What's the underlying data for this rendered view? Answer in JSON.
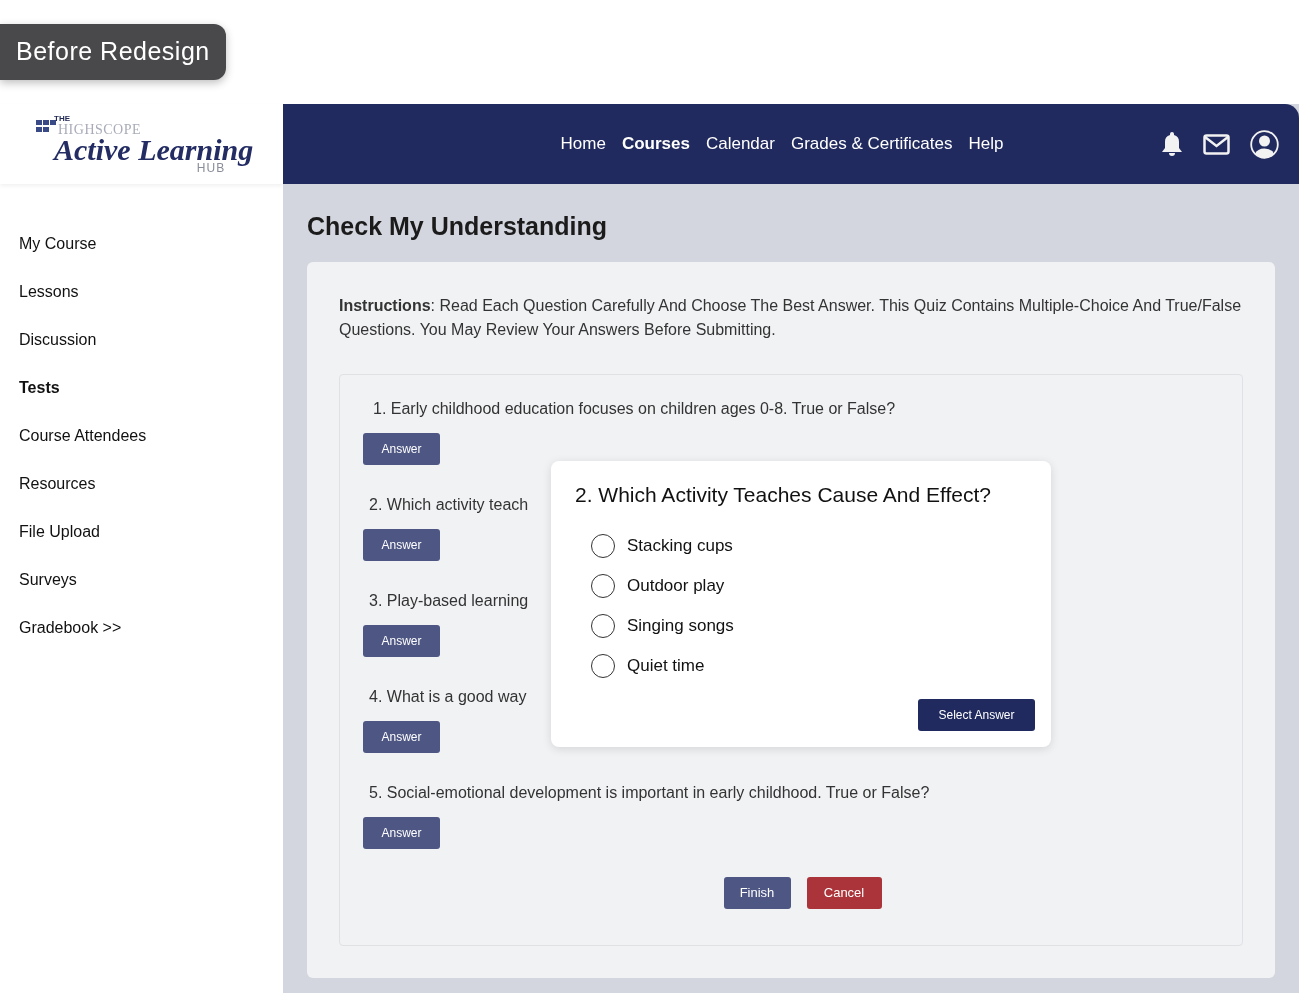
{
  "badge": "Before Redesign",
  "logo": {
    "the": "THE",
    "brand": "HIGHSCOPE",
    "name": "Active Learning",
    "hub": "HUB"
  },
  "nav": [
    {
      "label": "Home",
      "selected": false
    },
    {
      "label": "Courses",
      "selected": true
    },
    {
      "label": "Calendar",
      "selected": false
    },
    {
      "label": "Grades & Certificates",
      "selected": false
    },
    {
      "label": "Help",
      "selected": false
    }
  ],
  "sidebar": {
    "items": [
      {
        "label": "My Course",
        "selected": false
      },
      {
        "label": "Lessons",
        "selected": false
      },
      {
        "label": "Discussion",
        "selected": false
      },
      {
        "label": "Tests",
        "selected": true
      },
      {
        "label": "Course Attendees",
        "selected": false
      },
      {
        "label": "Resources",
        "selected": false
      },
      {
        "label": "File Upload",
        "selected": false
      },
      {
        "label": "Surveys",
        "selected": false
      },
      {
        "label": "Gradebook >>",
        "selected": false
      }
    ]
  },
  "page_title": "Check My Understanding",
  "instructions": "**Instructions**: Read Each Question Carefully And Choose The Best Answer. This Quiz Contains Multiple-Choice And True/False Questions. You May Review Your Answers Before Submitting.",
  "questions": [
    {
      "text": "1. Early childhood education focuses on children ages 0-8. True or False?",
      "button": "Answer"
    },
    {
      "text": "2. Which activity teach",
      "button": "Answer"
    },
    {
      "text": "3. Play-based learning",
      "button": "Answer"
    },
    {
      "text": "4. What is a good way",
      "button": "Answer"
    },
    {
      "text": "5. Social-emotional development is important in early childhood. True or False?",
      "button": "Answer"
    }
  ],
  "actions": {
    "finish": "Finish",
    "cancel": "Cancel"
  },
  "dialog": {
    "title": "2. Which Activity Teaches Cause And Effect?",
    "options": [
      {
        "label": "Stacking cups",
        "selected": false
      },
      {
        "label": "Outdoor play",
        "selected": false
      },
      {
        "label": "Singing songs",
        "selected": false
      },
      {
        "label": "Quiet time",
        "selected": false
      }
    ],
    "button": "Select Answer"
  }
}
